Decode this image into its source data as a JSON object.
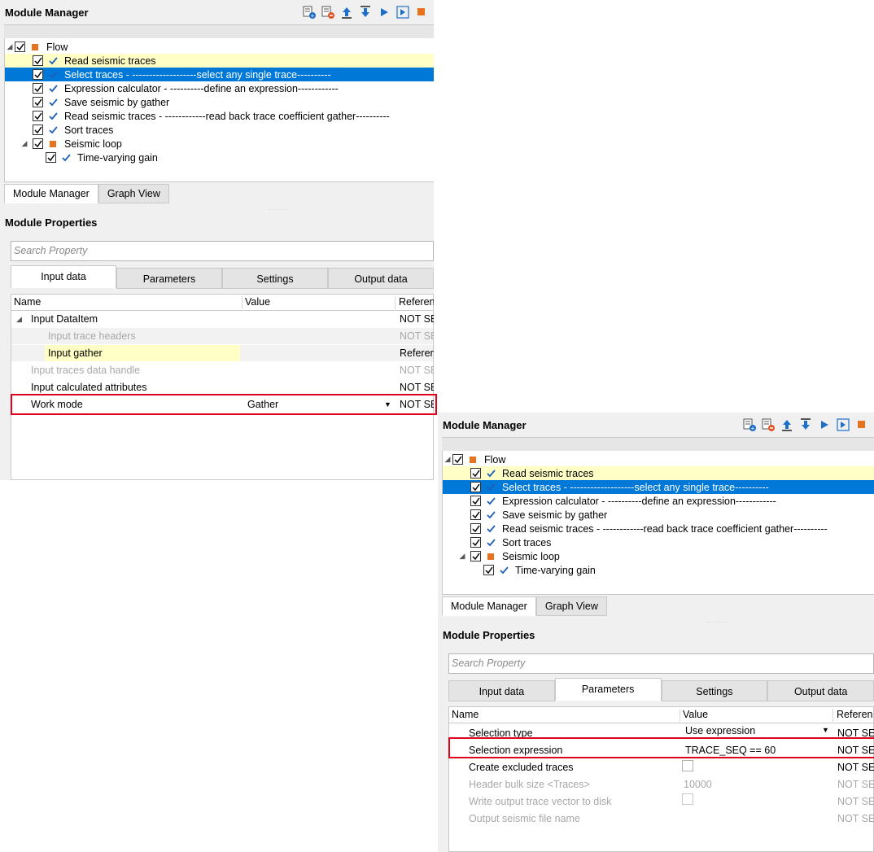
{
  "panel1": {
    "title": "Module Manager",
    "tree": [
      {
        "label": "Flow",
        "kind": "flow"
      },
      {
        "label": "Read seismic traces"
      },
      {
        "label": "Select traces - -------------------select any single trace----------"
      },
      {
        "label": "Expression calculator - ----------define an expression------------"
      },
      {
        "label": "Save seismic by gather"
      },
      {
        "label": "Read seismic traces - ------------read back trace coefficient gather----------"
      },
      {
        "label": "Sort traces"
      },
      {
        "label": "Seismic loop",
        "kind": "loop"
      },
      {
        "label": "Time-varying gain"
      }
    ],
    "bottom_tabs": [
      "Module Manager",
      "Graph View"
    ],
    "props_title": "Module Properties",
    "search_placeholder": "Search Property",
    "prop_tabs": [
      "Input data",
      "Parameters",
      "Settings",
      "Output data"
    ],
    "active_tab": "Input data",
    "columns": [
      "Name",
      "Value",
      "Referen"
    ],
    "rows": [
      {
        "name": "Input DataItem",
        "value": "",
        "ref": "NOT SET"
      },
      {
        "name": "Input trace headers",
        "value": "",
        "ref": "NOT SET"
      },
      {
        "name": "Input gather",
        "value": "",
        "ref": "Referen"
      },
      {
        "name": "Input traces data handle",
        "value": "",
        "ref": "NOT SET"
      },
      {
        "name": "Input calculated attributes",
        "value": "",
        "ref": "NOT SET"
      },
      {
        "name": "Work mode",
        "value": "Gather",
        "ref": "NOT SET"
      }
    ]
  },
  "panel2": {
    "title": "Module Manager",
    "tree": [
      {
        "label": "Flow"
      },
      {
        "label": "Read seismic traces"
      },
      {
        "label": "Select traces - -------------------select any single trace----------"
      },
      {
        "label": "Expression calculator - ----------define an expression------------"
      },
      {
        "label": "Save seismic by gather"
      },
      {
        "label": "Read seismic traces - ------------read back trace coefficient gather----------"
      },
      {
        "label": "Sort traces"
      },
      {
        "label": "Seismic loop"
      },
      {
        "label": "Time-varying gain"
      }
    ],
    "bottom_tabs": [
      "Module Manager",
      "Graph View"
    ],
    "props_title": "Module Properties",
    "search_placeholder": "Search Property",
    "prop_tabs": [
      "Input data",
      "Parameters",
      "Settings",
      "Output data"
    ],
    "active_tab": "Parameters",
    "columns": [
      "Name",
      "Value",
      "Referen"
    ],
    "rows": [
      {
        "name": "Selection type",
        "value": "Use expression",
        "ref": "NOT SET"
      },
      {
        "name": "Selection expression",
        "value": "TRACE_SEQ == 60",
        "ref": "NOT SET"
      },
      {
        "name": "Create excluded traces",
        "value": "",
        "ref": "NOT SET"
      },
      {
        "name": "Header bulk size <Traces>",
        "value": "10000",
        "ref": "NOT SET"
      },
      {
        "name": "Write output trace vector to disk",
        "value": "",
        "ref": "NOT SET"
      },
      {
        "name": "Output seismic file name",
        "value": "",
        "ref": "NOT SET"
      }
    ]
  },
  "icons": [
    "add-module-icon",
    "remove-module-icon",
    "move-up-icon",
    "move-down-icon",
    "run-icon",
    "run-step-icon",
    "stop-icon"
  ],
  "colors": {
    "selection": "#0078d7",
    "highlight": "#ffffc6",
    "annotation": "#e0001b",
    "flow_square": "#e8731f"
  }
}
